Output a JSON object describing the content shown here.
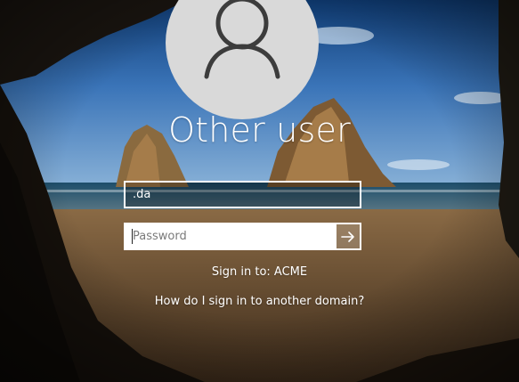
{
  "login": {
    "title": "Other user",
    "username_value": ".da",
    "password_placeholder": "Password",
    "sign_in_to": "Sign in to: ACME",
    "help_link": "How do I sign in to another domain?"
  },
  "icons": {
    "avatar": "user-silhouette-icon",
    "submit": "arrow-right-icon"
  },
  "colors": {
    "avatar_bg": "#d9d9d9",
    "avatar_glyph": "#3c3c3c",
    "field_border": "#ffffff",
    "text": "#ffffff"
  }
}
